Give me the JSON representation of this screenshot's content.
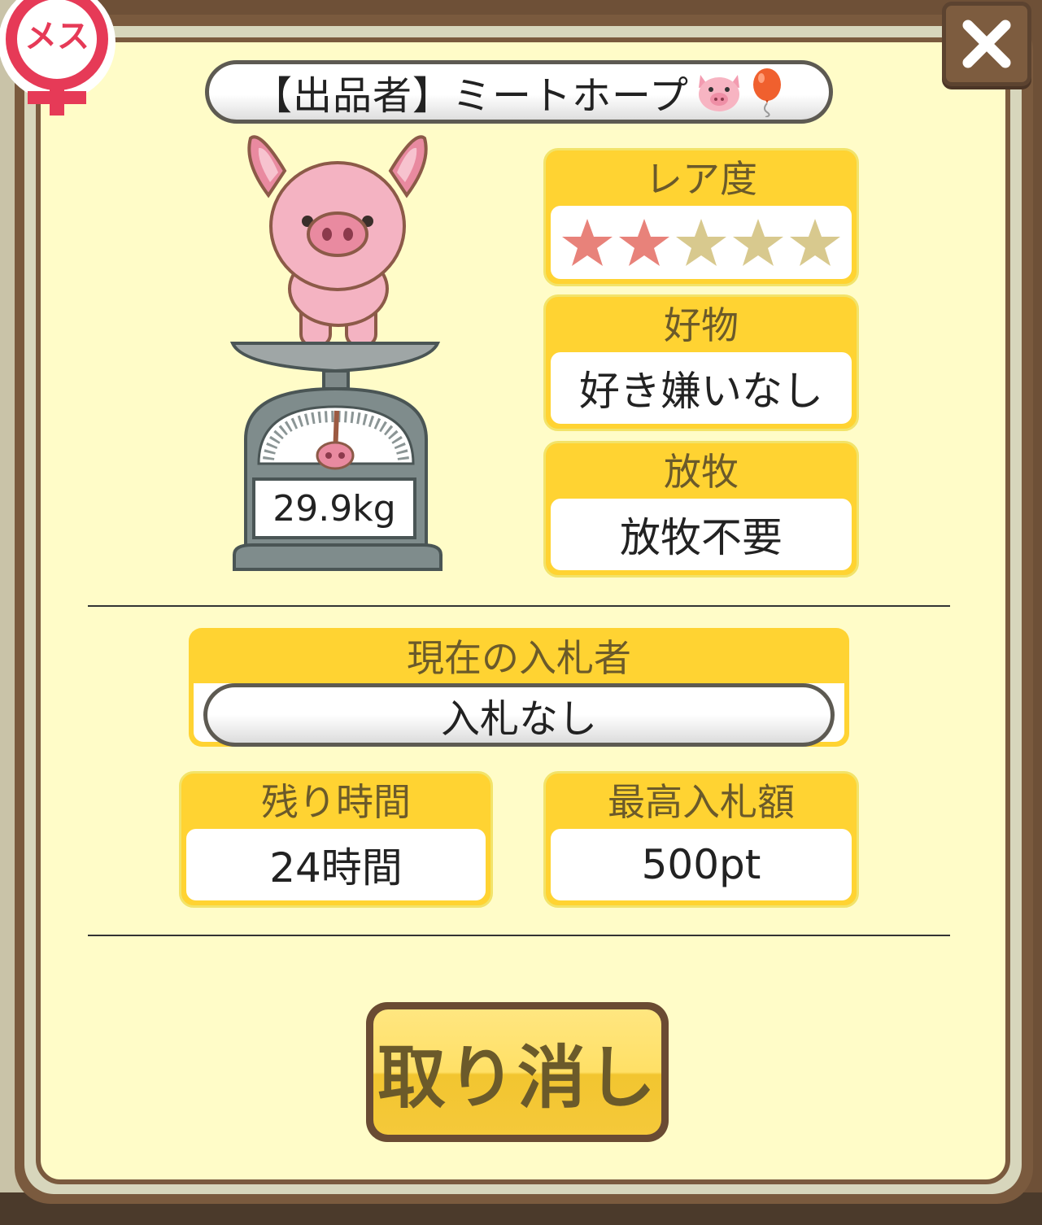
{
  "badge": {
    "label": "メス"
  },
  "seller": {
    "text": "【出品者】ミートホープ"
  },
  "weight": {
    "value": "29.9kg"
  },
  "rarity": {
    "label": "レア度",
    "stars_filled": 2,
    "stars_total": 5,
    "filled_color": "#e8827a",
    "empty_color": "#d8c98e"
  },
  "favorite": {
    "label": "好物",
    "value": "好き嫌いなし"
  },
  "grazing": {
    "label": "放牧",
    "value": "放牧不要"
  },
  "bidder": {
    "label": "現在の入札者",
    "value": "入札なし"
  },
  "remaining": {
    "label": "残り時間",
    "value": "24時間"
  },
  "highest_bid": {
    "label": "最高入札額",
    "value": "500pt"
  },
  "cancel_button": {
    "label": "取り消し"
  },
  "colors": {
    "panel": "#fffcc8",
    "card": "#ffd332",
    "frame": "#7a5a3e",
    "accent_pink": "#e83a5a"
  }
}
